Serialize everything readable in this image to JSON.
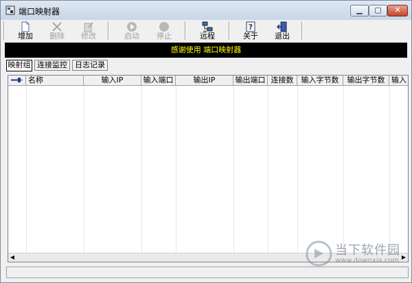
{
  "window": {
    "title": "端口映射器"
  },
  "toolbar": {
    "buttons": [
      {
        "label": "增加",
        "icon": "new-document-icon",
        "enabled": true
      },
      {
        "label": "删除",
        "icon": "delete-x-icon",
        "enabled": false
      },
      {
        "label": "修改",
        "icon": "edit-icon",
        "enabled": false
      },
      {
        "label": "启动",
        "icon": "play-icon",
        "enabled": false
      },
      {
        "label": "停止",
        "icon": "stop-icon",
        "enabled": false
      },
      {
        "label": "远程",
        "icon": "remote-network-icon",
        "enabled": true
      },
      {
        "label": "关于",
        "icon": "help-icon",
        "enabled": true
      },
      {
        "label": "退出",
        "icon": "exit-door-icon",
        "enabled": true
      }
    ]
  },
  "banner": {
    "text": "感谢使用 端口映射器"
  },
  "tabs": [
    {
      "label": "映射组",
      "active": true
    },
    {
      "label": "连接监控",
      "active": false
    },
    {
      "label": "日志记录",
      "active": false
    }
  ],
  "grid": {
    "columns": [
      "名称",
      "输入IP",
      "输入端口",
      "输出IP",
      "输出端口",
      "连接数",
      "输入字节数",
      "输出字节数",
      "输入"
    ]
  },
  "watermark": {
    "text": "当下软件园",
    "url": "www.downxia.com"
  },
  "colors": {
    "banner_bg": "#000000",
    "banner_text": "#ffff00"
  }
}
